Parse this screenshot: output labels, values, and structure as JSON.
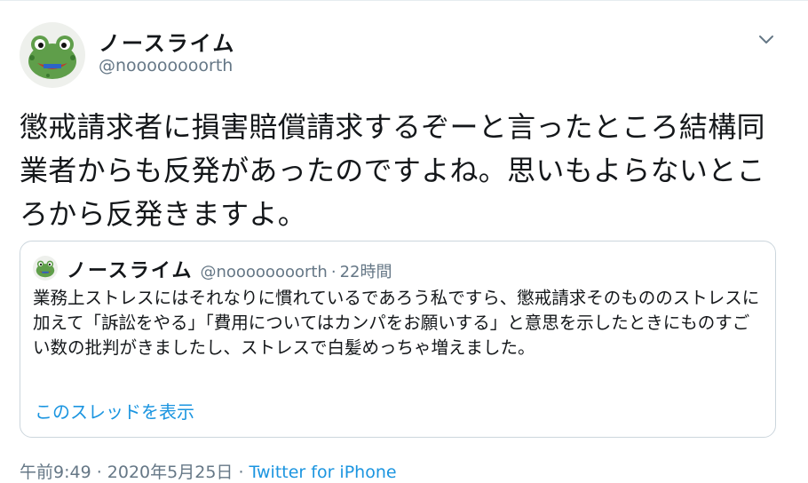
{
  "author": {
    "display_name": "ノースライム",
    "handle": "@noooooooorth"
  },
  "tweet": {
    "text": "懲戒請求者に損害賠償請求するぞーと言ったところ結構同業者からも反発があったのですよね。思いもよらないところから反発きますよ。"
  },
  "quoted_tweet": {
    "display_name": "ノースライム",
    "handle": "@noooooooorth",
    "separator": "·",
    "time": "22時間",
    "text": "業務上ストレスにはそれなりに慣れているであろう私ですら、懲戒請求そのもののストレスに加えて「訴訟をやる」「費用についてはカンパをお願いする」と意思を示したときにものすごい数の批判がきましたし、ストレスで白髪めっちゃ増えました。",
    "thread_link": "このスレッドを表示"
  },
  "meta": {
    "time": "午前9:49",
    "sep1": " · ",
    "date": "2020年5月25日",
    "sep2": " · ",
    "source": "Twitter for iPhone"
  },
  "icons": {
    "avatar": "green-frog-character-avatar",
    "menu": "chevron-down-icon"
  },
  "colors": {
    "link": "#1b95e0",
    "secondary": "#657786",
    "border": "#ccd6dd"
  }
}
